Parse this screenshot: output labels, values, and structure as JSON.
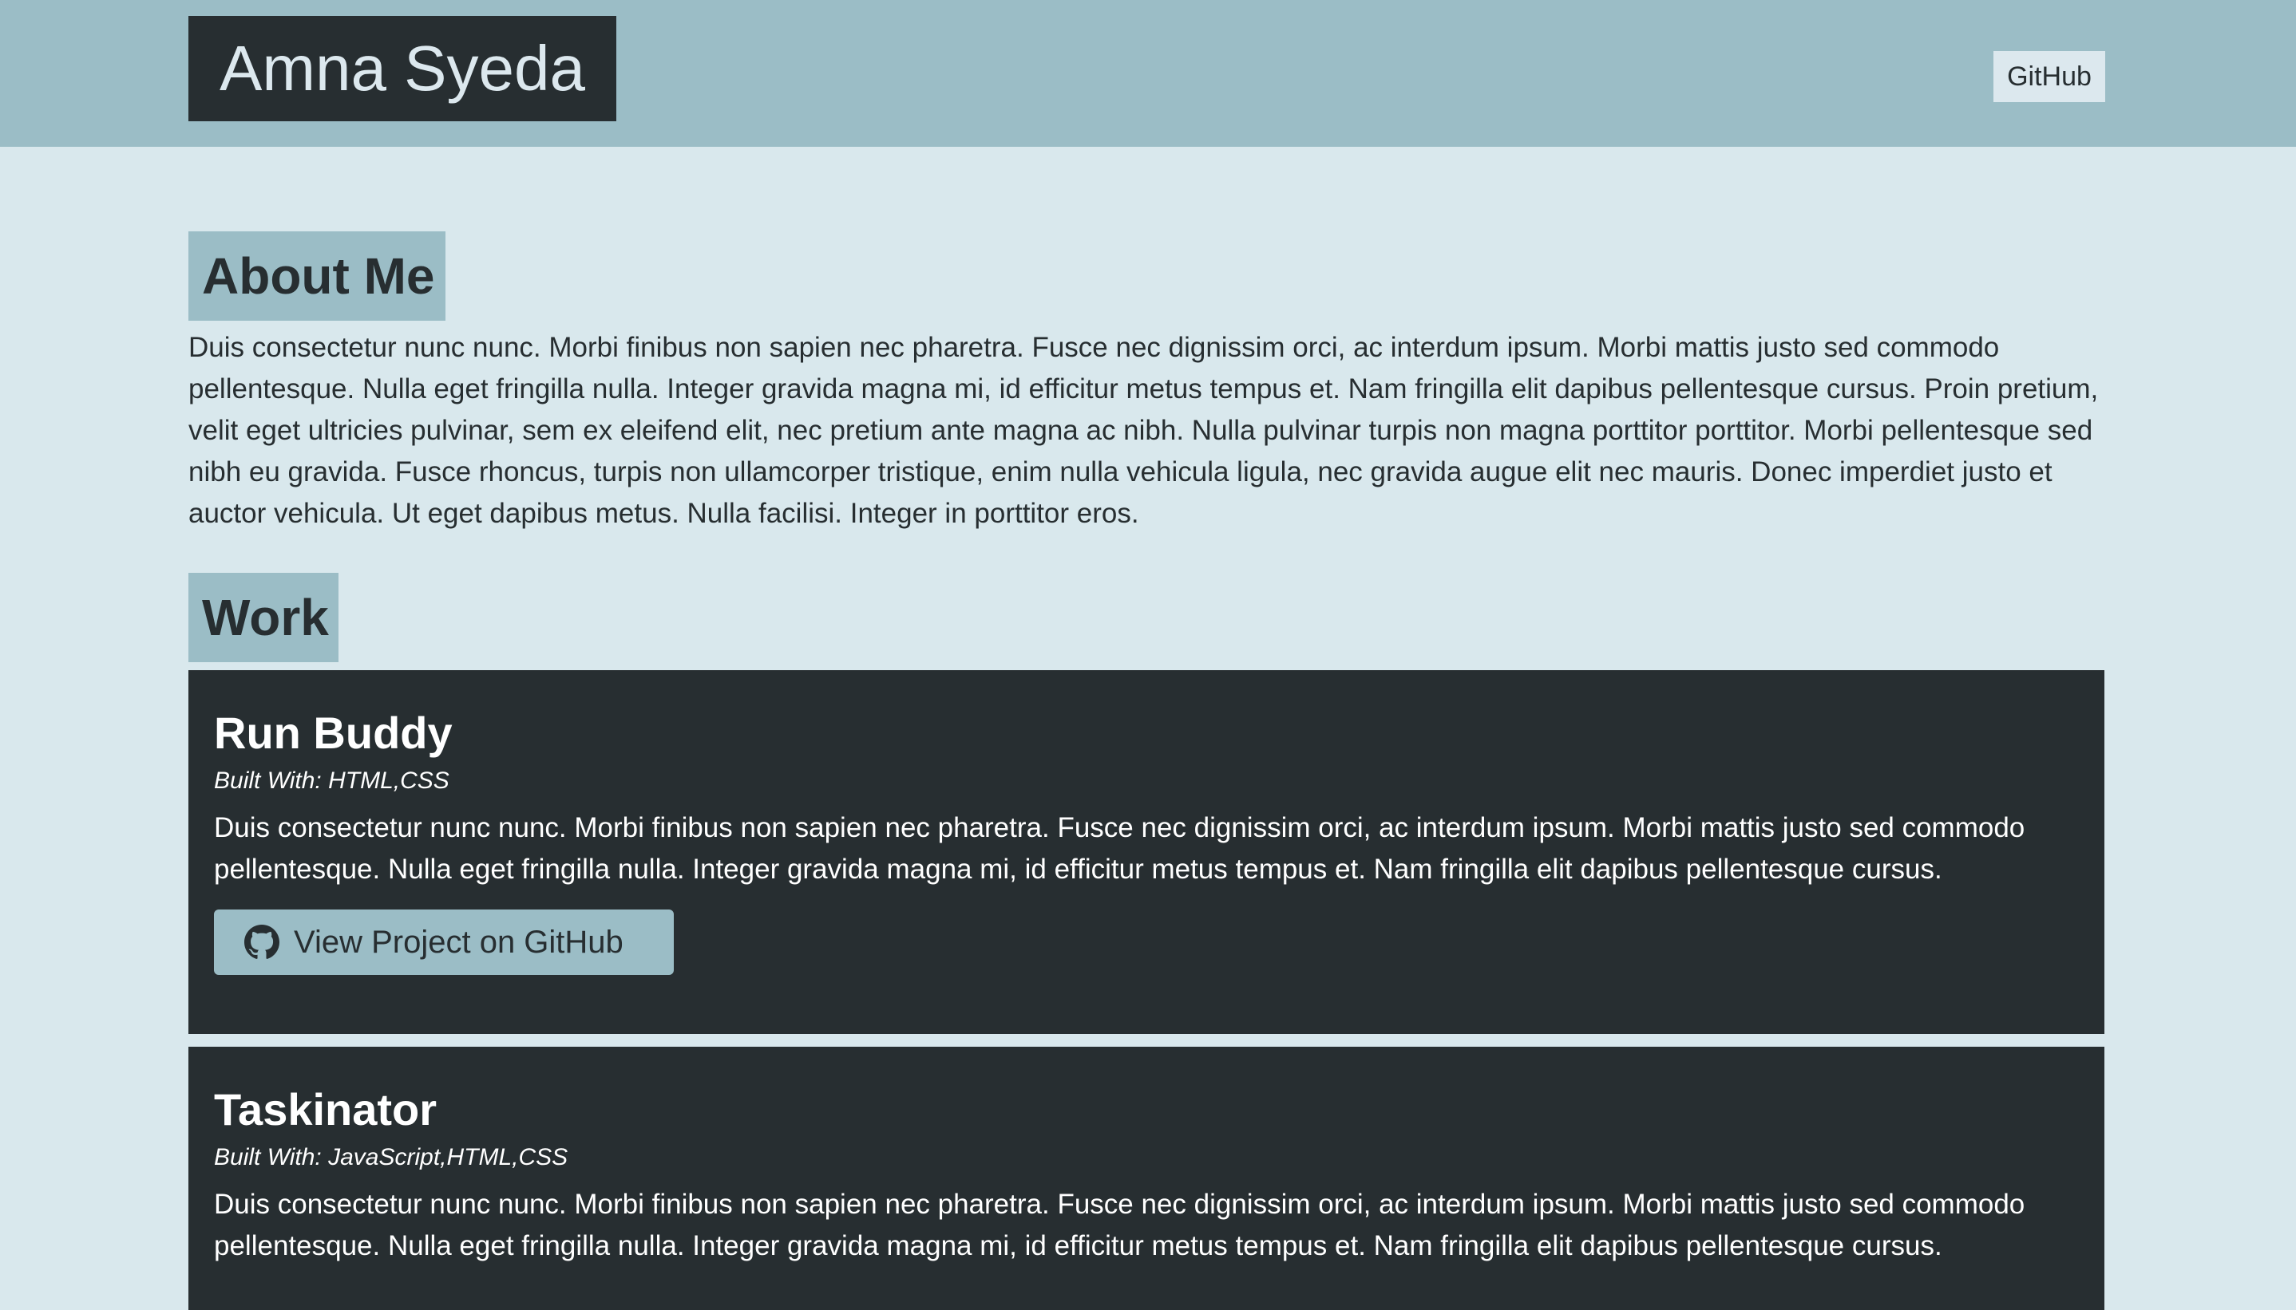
{
  "header": {
    "brand": "Amna Syeda",
    "nav_github": "GitHub"
  },
  "about": {
    "title": "About Me",
    "text": "Duis consectetur nunc nunc. Morbi finibus non sapien nec pharetra. Fusce nec dignissim orci, ac interdum ipsum. Morbi mattis justo sed commodo pellentesque. Nulla eget fringilla nulla. Integer gravida magna mi, id efficitur metus tempus et. Nam fringilla elit dapibus pellentesque cursus. Proin pretium, velit eget ultricies pulvinar, sem ex eleifend elit, nec pretium ante magna ac nibh. Nulla pulvinar turpis non magna porttitor porttitor. Morbi pellentesque sed nibh eu gravida. Fusce rhoncus, turpis non ullamcorper tristique, enim nulla vehicula ligula, nec gravida augue elit nec mauris. Donec imperdiet justo et auctor vehicula. Ut eget dapibus metus. Nulla facilisi. Integer in porttitor eros."
  },
  "work": {
    "title": "Work",
    "projects": [
      {
        "title": "Run Buddy",
        "built_with": "Built With: HTML,CSS",
        "description": "Duis consectetur nunc nunc. Morbi finibus non sapien nec pharetra. Fusce nec dignissim orci, ac interdum ipsum. Morbi mattis justo sed commodo pellentesque. Nulla eget fringilla nulla. Integer gravida magna mi, id efficitur metus tempus et. Nam fringilla elit dapibus pellentesque cursus.",
        "button_label": "View Project on GitHub",
        "button_icon": "github-icon"
      },
      {
        "title": "Taskinator",
        "built_with": "Built With: JavaScript,HTML,CSS",
        "description": "Duis consectetur nunc nunc. Morbi finibus non sapien nec pharetra. Fusce nec dignissim orci, ac interdum ipsum. Morbi mattis justo sed commodo pellentesque. Nulla eget fringilla nulla. Integer gravida magna mi, id efficitur metus tempus et. Nam fringilla elit dapibus pellentesque cursus."
      }
    ]
  },
  "colors": {
    "header_bg": "#9bbdc6",
    "page_bg": "#d9e8ed",
    "dark": "#272e31",
    "light": "#dce8ee"
  }
}
